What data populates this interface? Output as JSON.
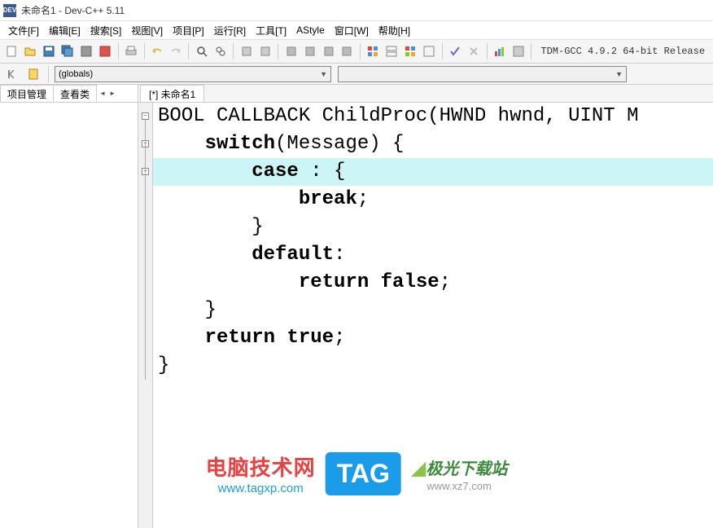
{
  "window": {
    "title": "未命名1 - Dev-C++ 5.11",
    "icon_label": "DEV"
  },
  "menu": {
    "file": "文件[F]",
    "edit": "编辑[E]",
    "search": "搜索[S]",
    "view": "视图[V]",
    "project": "项目[P]",
    "run": "运行[R]",
    "tools": "工具[T]",
    "astyle": "AStyle",
    "window": "窗口[W]",
    "help": "帮助[H]"
  },
  "toolbar": {
    "compiler_status": "TDM-GCC 4.9.2 64-bit Release"
  },
  "toolbar2": {
    "globals_label": "(globals)"
  },
  "left_panel": {
    "tabs": [
      "项目管理",
      "查看类"
    ]
  },
  "editor": {
    "tab": "[*] 未命名1",
    "lines": [
      {
        "text": "BOOL CALLBACK ChildProc(HWND hwnd, UINT M",
        "indent": 0,
        "kw": []
      },
      {
        "text": "    switch(Message) {",
        "indent": 1,
        "kw": [
          "switch"
        ]
      },
      {
        "text": "        case : {",
        "indent": 2,
        "kw": [
          "case"
        ],
        "highlight": true
      },
      {
        "text": "            break;",
        "indent": 3,
        "kw": [
          "break"
        ]
      },
      {
        "text": "        }",
        "indent": 2,
        "kw": []
      },
      {
        "text": "        default:",
        "indent": 2,
        "kw": [
          "default"
        ]
      },
      {
        "text": "            return false;",
        "indent": 3,
        "kw": [
          "return",
          "false"
        ]
      },
      {
        "text": "    }",
        "indent": 1,
        "kw": []
      },
      {
        "text": "    return true;",
        "indent": 1,
        "kw": [
          "return",
          "true"
        ]
      },
      {
        "text": "}",
        "indent": 0,
        "kw": []
      }
    ]
  },
  "watermark": {
    "title": "电脑技术网",
    "url": "www.tagxp.com",
    "tag": "TAG",
    "logo": "极光下载站",
    "url2": "www.xz7.com"
  }
}
